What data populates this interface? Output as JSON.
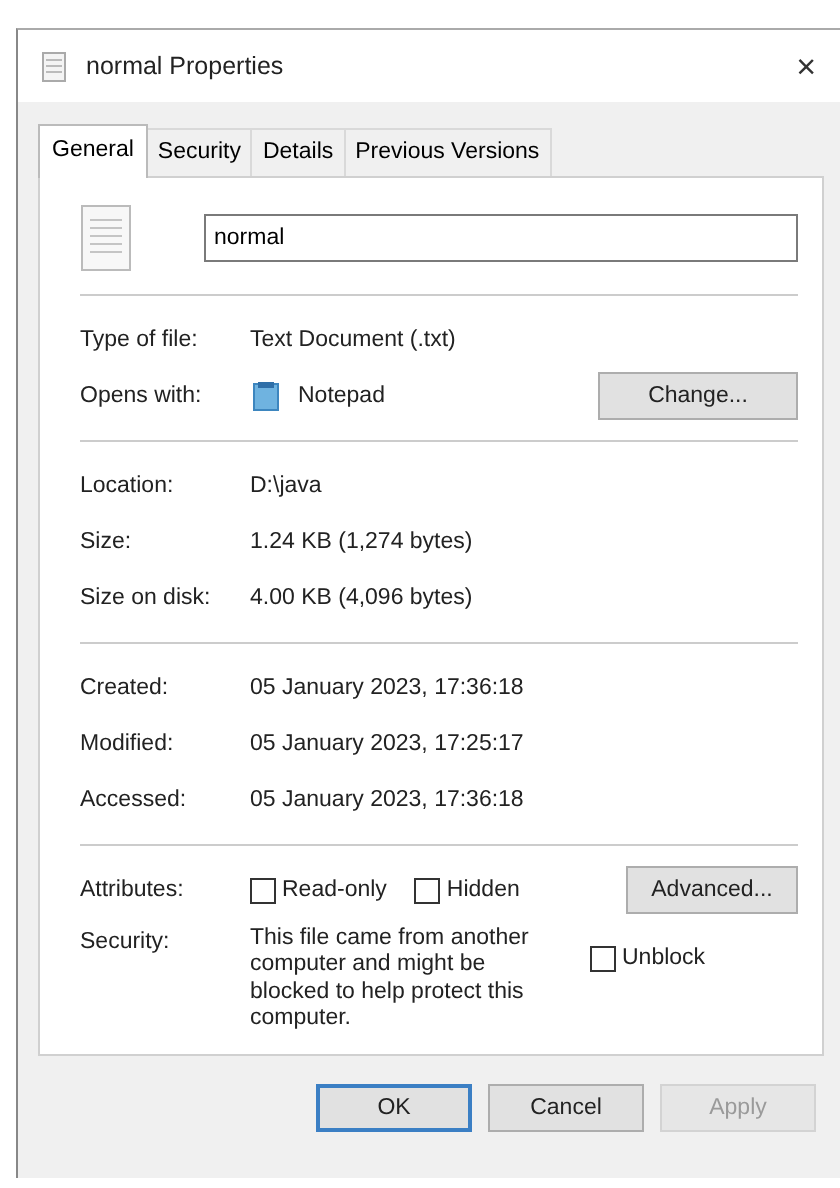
{
  "window": {
    "title": "normal Properties",
    "close": "×"
  },
  "tabs": [
    {
      "label": "General",
      "selected": true
    },
    {
      "label": "Security",
      "selected": false
    },
    {
      "label": "Details",
      "selected": false
    },
    {
      "label": "Previous Versions",
      "selected": false
    }
  ],
  "file_name": "normal",
  "groups": [
    [
      {
        "label": "Type of file:",
        "value": "Text Document (.txt)"
      },
      {
        "label": "Opens with:",
        "value": "Notepad",
        "kind": "app",
        "button": "Change..."
      }
    ],
    [
      {
        "label": "Location:",
        "value": "D:\\java"
      },
      {
        "label": "Size:",
        "value": "1.24 KB (1,274 bytes)"
      },
      {
        "label": "Size on disk:",
        "value": "4.00 KB (4,096 bytes)"
      }
    ],
    [
      {
        "label": "Created:",
        "value": "05 January 2023, 17:36:18"
      },
      {
        "label": "Modified:",
        "value": "05 January 2023, 17:25:17"
      },
      {
        "label": "Accessed:",
        "value": "05 January 2023, 17:36:18"
      }
    ]
  ],
  "attributes": {
    "label": "Attributes:",
    "checkboxes": [
      {
        "label": "Read-only",
        "checked": false
      },
      {
        "label": "Hidden",
        "checked": false
      }
    ],
    "button": "Advanced..."
  },
  "security": {
    "label": "Security:",
    "text": "This file came from another computer and might be blocked to help protect this computer.",
    "checkbox": {
      "label": "Unblock",
      "checked": false
    }
  },
  "buttons": [
    {
      "label": "OK",
      "default": true,
      "disabled": false
    },
    {
      "label": "Cancel",
      "default": false,
      "disabled": false
    },
    {
      "label": "Apply",
      "default": false,
      "disabled": true
    }
  ]
}
